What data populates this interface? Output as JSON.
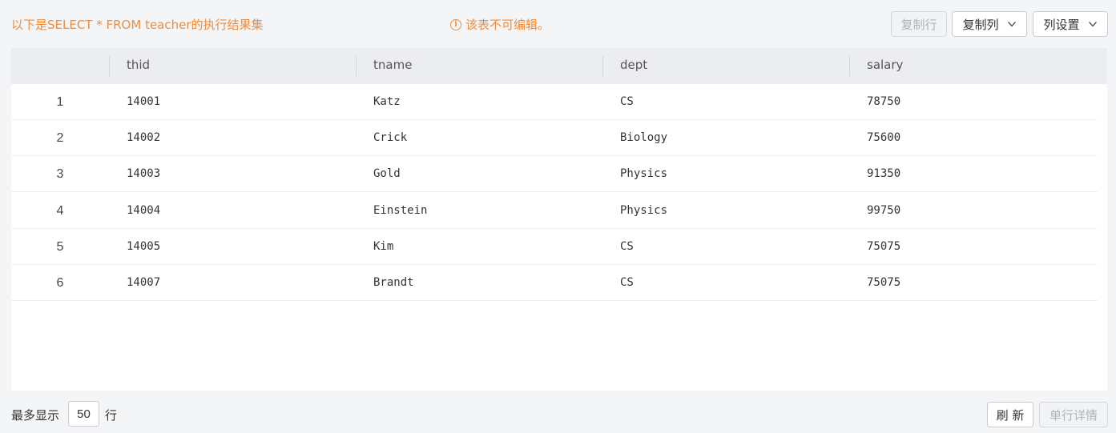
{
  "header": {
    "query_title": "以下是SELECT * FROM teacher的执行结果集",
    "warning": "该表不可编辑。",
    "warning_icon": "info-circle-icon",
    "copy_row_label": "复制行",
    "copy_col_label": "复制列",
    "col_settings_label": "列设置"
  },
  "table": {
    "columns": [
      "thid",
      "tname",
      "dept",
      "salary"
    ],
    "rows": [
      {
        "num": "1",
        "thid": "14001",
        "tname": "Katz",
        "dept": "CS",
        "salary": "78750"
      },
      {
        "num": "2",
        "thid": "14002",
        "tname": "Crick",
        "dept": "Biology",
        "salary": "75600"
      },
      {
        "num": "3",
        "thid": "14003",
        "tname": "Gold",
        "dept": "Physics",
        "salary": "91350"
      },
      {
        "num": "4",
        "thid": "14004",
        "tname": "Einstein",
        "dept": "Physics",
        "salary": "99750"
      },
      {
        "num": "5",
        "thid": "14005",
        "tname": "Kim",
        "dept": "CS",
        "salary": "75075"
      },
      {
        "num": "6",
        "thid": "14007",
        "tname": "Brandt",
        "dept": "CS",
        "salary": "75075"
      }
    ]
  },
  "footer": {
    "max_show_label": "最多显示",
    "limit_value": "50",
    "rows_suffix": "行",
    "refresh_label": "刷 新",
    "row_detail_label": "单行详情"
  },
  "colors": {
    "accent": "#f08c3c",
    "header_bg": "#ebedf0",
    "page_bg": "#f4f5f7"
  }
}
